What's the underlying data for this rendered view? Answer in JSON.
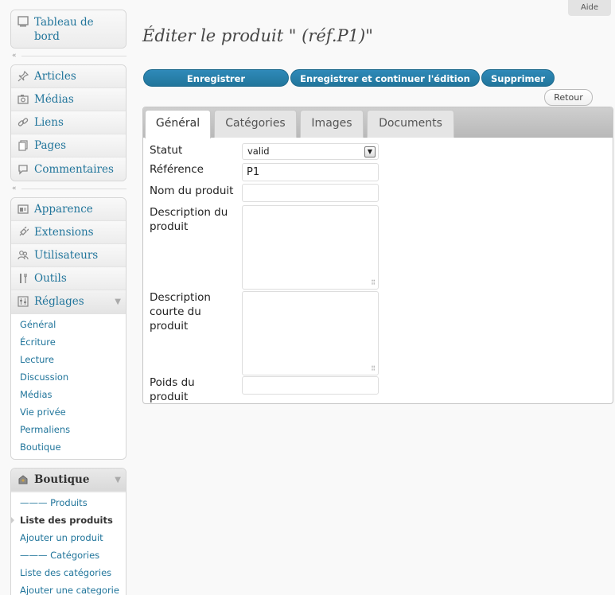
{
  "help_label": "Aide",
  "sidebar": {
    "group1": [
      {
        "label": "Tableau de bord",
        "icon": "dashboard-icon"
      }
    ],
    "group2": [
      {
        "label": "Articles",
        "icon": "pin-icon"
      },
      {
        "label": "Médias",
        "icon": "media-icon"
      },
      {
        "label": "Liens",
        "icon": "link-icon"
      },
      {
        "label": "Pages",
        "icon": "pages-icon"
      },
      {
        "label": "Commentaires",
        "icon": "comment-icon"
      }
    ],
    "group3": [
      {
        "label": "Apparence",
        "icon": "appearance-icon"
      },
      {
        "label": "Extensions",
        "icon": "plugin-icon"
      },
      {
        "label": "Utilisateurs",
        "icon": "users-icon"
      },
      {
        "label": "Outils",
        "icon": "tools-icon"
      },
      {
        "label": "Réglages",
        "icon": "settings-icon"
      }
    ],
    "settings_sub": [
      "Général",
      "Écriture",
      "Lecture",
      "Discussion",
      "Médias",
      "Vie privée",
      "Permaliens",
      "Boutique"
    ],
    "boutique": {
      "label": "Boutique",
      "items": [
        "——— Produits",
        "Liste des produits",
        "Ajouter un produit",
        "——— Catégories",
        "Liste des catégories",
        "Ajouter une categorie"
      ]
    }
  },
  "page": {
    "title": "Éditer le produit \" (réf.P1)\"",
    "buttons": {
      "save": "Enregistrer",
      "save_continue": "Enregistrer et continuer l'édition",
      "delete": "Supprimer",
      "back": "Retour"
    },
    "tabs": [
      "Général",
      "Catégories",
      "Images",
      "Documents"
    ],
    "form": {
      "statut_label": "Statut",
      "statut_value": "valid",
      "reference_label": "Référence",
      "reference_value": "P1",
      "nom_label": "Nom du produit",
      "nom_value": "",
      "description_label_1": "Description du",
      "description_label_2": "produit",
      "desc_courte_label_1": "Description",
      "desc_courte_label_2": "courte du",
      "desc_courte_label_3": "produit",
      "poids_label_1": "Poids du",
      "poids_label_2": "produit",
      "poids_value": ""
    }
  },
  "colors": {
    "link": "#21759b",
    "button": "#21759b"
  }
}
